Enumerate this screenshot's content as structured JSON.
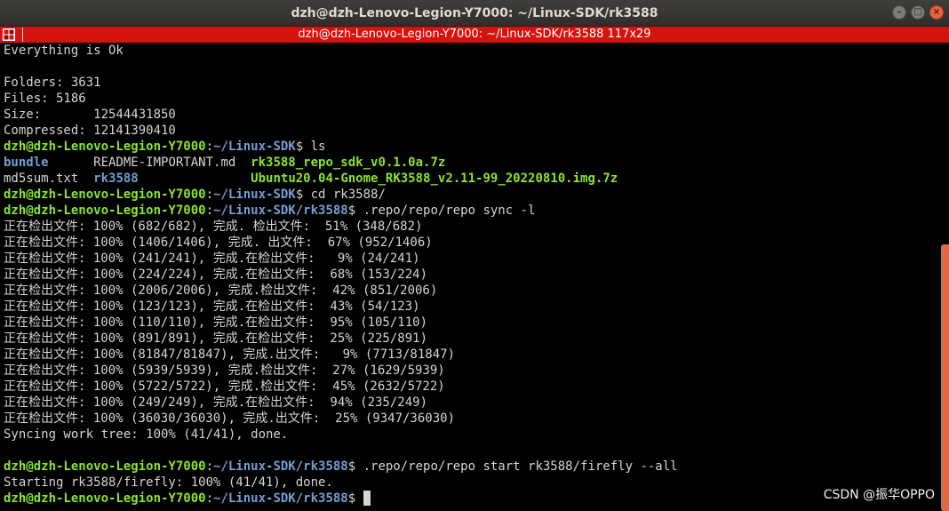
{
  "window": {
    "title": "dzh@dzh-Lenovo-Legion-Y7000: ~/Linux-SDK/rk3588",
    "buttons": {
      "minimize": "–",
      "maximize": "□",
      "close": "×"
    }
  },
  "terminal_bar": {
    "title": "dzh@dzh-Lenovo-Legion-Y7000: ~/Linux-SDK/rk3588 117x29"
  },
  "colors": {
    "prompt_user": "#8ae234",
    "prompt_path": "#729fcf",
    "terminal_fg": "#d3d7cf",
    "terminal_bg": "#000000",
    "title_bar_red": "#d4120e",
    "scrollbar": "#e3683e"
  },
  "terminal": {
    "lines": [
      [
        {
          "t": "Everything is Ok",
          "c": "n"
        }
      ],
      [],
      [
        {
          "t": "Folders: 3631",
          "c": "n"
        }
      ],
      [
        {
          "t": "Files: 5186",
          "c": "n"
        }
      ],
      [
        {
          "t": "Size:       12544431850",
          "c": "n"
        }
      ],
      [
        {
          "t": "Compressed: 12141390410",
          "c": "n"
        }
      ],
      [
        {
          "t": "dzh@dzh-Lenovo-Legion-Y7000",
          "c": "g"
        },
        {
          "t": ":",
          "c": "n"
        },
        {
          "t": "~/Linux-SDK",
          "c": "b"
        },
        {
          "t": "$ ls",
          "c": "n"
        }
      ],
      [
        {
          "t": "bundle",
          "c": "b"
        },
        {
          "t": "      README-IMPORTANT.md  ",
          "c": "n"
        },
        {
          "t": "rk3588_repo_sdk_v0.1.0a.7z",
          "c": "g"
        }
      ],
      [
        {
          "t": "md5sum.txt  ",
          "c": "n"
        },
        {
          "t": "rk3588",
          "c": "b"
        },
        {
          "t": "               ",
          "c": "n"
        },
        {
          "t": "Ubuntu20.04-Gnome_RK3588_v2.11-99_20220810.img.7z",
          "c": "g"
        }
      ],
      [
        {
          "t": "dzh@dzh-Lenovo-Legion-Y7000",
          "c": "g"
        },
        {
          "t": ":",
          "c": "n"
        },
        {
          "t": "~/Linux-SDK",
          "c": "b"
        },
        {
          "t": "$ cd rk3588/",
          "c": "n"
        }
      ],
      [
        {
          "t": "dzh@dzh-Lenovo-Legion-Y7000",
          "c": "g"
        },
        {
          "t": ":",
          "c": "n"
        },
        {
          "t": "~/Linux-SDK/rk3588",
          "c": "b"
        },
        {
          "t": "$ .repo/repo/repo sync -l",
          "c": "n"
        }
      ],
      [
        {
          "t": "正在检出文件: 100% (682/682), 完成. 检出文件:  51% (348/682)",
          "c": "n"
        }
      ],
      [
        {
          "t": "正在检出文件: 100% (1406/1406), 完成. 出文件:  67% (952/1406)",
          "c": "n"
        }
      ],
      [
        {
          "t": "正在检出文件: 100% (241/241), 完成.在检出文件:   9% (24/241)",
          "c": "n"
        }
      ],
      [
        {
          "t": "正在检出文件: 100% (224/224), 完成.在检出文件:  68% (153/224)",
          "c": "n"
        }
      ],
      [
        {
          "t": "正在检出文件: 100% (2006/2006), 完成.检出文件:  42% (851/2006)",
          "c": "n"
        }
      ],
      [
        {
          "t": "正在检出文件: 100% (123/123), 完成.在检出文件:  43% (54/123)",
          "c": "n"
        }
      ],
      [
        {
          "t": "正在检出文件: 100% (110/110), 完成.在检出文件:  95% (105/110)",
          "c": "n"
        }
      ],
      [
        {
          "t": "正在检出文件: 100% (891/891), 完成.在检出文件:  25% (225/891)",
          "c": "n"
        }
      ],
      [
        {
          "t": "正在检出文件: 100% (81847/81847), 完成.出文件:   9% (7713/81847)",
          "c": "n"
        }
      ],
      [
        {
          "t": "正在检出文件: 100% (5939/5939), 完成.检出文件:  27% (1629/5939)",
          "c": "n"
        }
      ],
      [
        {
          "t": "正在检出文件: 100% (5722/5722), 完成.检出文件:  45% (2632/5722)",
          "c": "n"
        }
      ],
      [
        {
          "t": "正在检出文件: 100% (249/249), 完成.在检出文件:  94% (235/249)",
          "c": "n"
        }
      ],
      [
        {
          "t": "正在检出文件: 100% (36030/36030), 完成.出文件:  25% (9347/36030)",
          "c": "n"
        }
      ],
      [
        {
          "t": "Syncing work tree: 100% (41/41), done.",
          "c": "n"
        }
      ],
      [],
      [
        {
          "t": "dzh@dzh-Lenovo-Legion-Y7000",
          "c": "g"
        },
        {
          "t": ":",
          "c": "n"
        },
        {
          "t": "~/Linux-SDK/rk3588",
          "c": "b"
        },
        {
          "t": "$ .repo/repo/repo start rk3588/firefly --all",
          "c": "n"
        }
      ],
      [
        {
          "t": "Starting rk3588/firefly: 100% (41/41), done.",
          "c": "n"
        }
      ],
      [
        {
          "t": "dzh@dzh-Lenovo-Legion-Y7000",
          "c": "g"
        },
        {
          "t": ":",
          "c": "n"
        },
        {
          "t": "~/Linux-SDK/rk3588",
          "c": "b"
        },
        {
          "t": "$ ",
          "c": "n"
        }
      ]
    ]
  },
  "watermark": "CSDN @振华OPPO"
}
